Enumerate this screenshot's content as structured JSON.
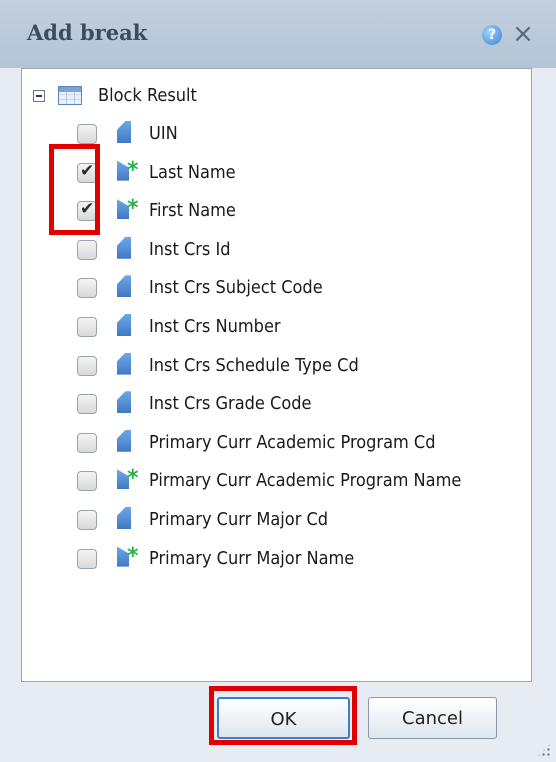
{
  "dialog": {
    "title": "Add break",
    "help_icon": "help-icon",
    "close_icon": "close-icon"
  },
  "tree": {
    "root_label": "Block Result",
    "root_icon": "table-icon",
    "expander_icon": "collapse-icon",
    "items": [
      {
        "label": "UIN",
        "checked": false,
        "icon": "dimension-icon"
      },
      {
        "label": "Last Name",
        "checked": true,
        "icon": "detail-icon"
      },
      {
        "label": "First Name",
        "checked": true,
        "icon": "detail-icon"
      },
      {
        "label": "Inst Crs Id",
        "checked": false,
        "icon": "dimension-icon"
      },
      {
        "label": "Inst Crs Subject Code",
        "checked": false,
        "icon": "dimension-icon"
      },
      {
        "label": "Inst Crs Number",
        "checked": false,
        "icon": "dimension-icon"
      },
      {
        "label": "Inst Crs Schedule Type Cd",
        "checked": false,
        "icon": "dimension-icon"
      },
      {
        "label": "Inst Crs Grade Code",
        "checked": false,
        "icon": "dimension-icon"
      },
      {
        "label": "Primary Curr Academic Program Cd",
        "checked": false,
        "icon": "dimension-icon"
      },
      {
        "label": "Pirmary Curr Academic Program Name",
        "checked": false,
        "icon": "detail-icon"
      },
      {
        "label": "Primary Curr Major Cd",
        "checked": false,
        "icon": "dimension-icon"
      },
      {
        "label": "Primary Curr Major Name",
        "checked": false,
        "icon": "detail-icon"
      }
    ]
  },
  "buttons": {
    "ok_label": "OK",
    "cancel_label": "Cancel"
  },
  "colors": {
    "highlight": "#e00000",
    "title_bar": "#b4c4d6",
    "detail_star": "#2bb24a"
  }
}
